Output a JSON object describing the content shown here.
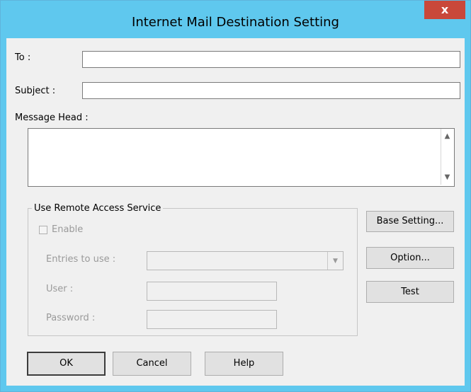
{
  "dialog": {
    "title": "Internet Mail Destination Setting",
    "close_label": "x"
  },
  "fields": {
    "to_label": "To :",
    "to_value": "",
    "subject_label": "Subject :",
    "subject_value": "",
    "message_head_label": "Message Head :",
    "message_head_value": ""
  },
  "ras": {
    "group_label": "Use Remote Access Service",
    "enable_label": "Enable",
    "enable_checked": false,
    "entries_label": "Entries to use :",
    "entries_value": "",
    "user_label": "User :",
    "user_value": "",
    "password_label": "Password :",
    "password_value": ""
  },
  "side_buttons": {
    "base_setting": "Base Setting...",
    "option": "Option...",
    "test": "Test"
  },
  "bottom_buttons": {
    "ok": "OK",
    "cancel": "Cancel",
    "help": "Help"
  }
}
